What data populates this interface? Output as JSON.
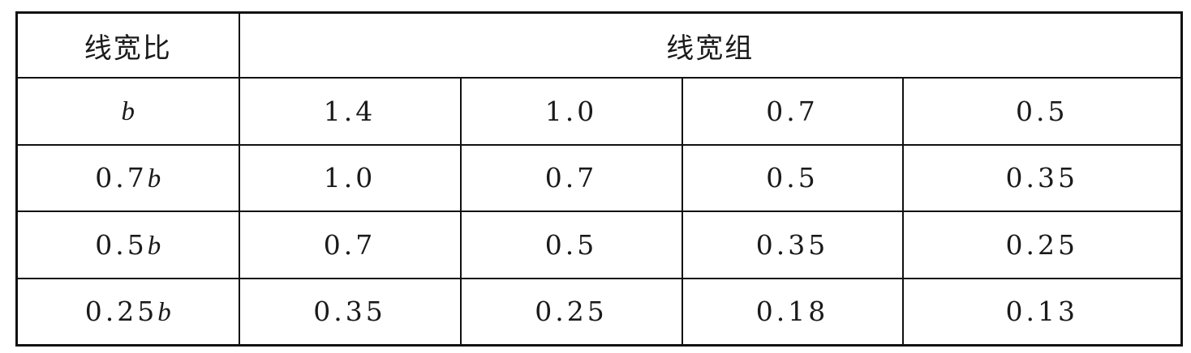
{
  "table": {
    "header": {
      "ratio_label": "线宽比",
      "group_label": "线宽组"
    },
    "rows": [
      {
        "ratio_num": "",
        "ratio_var": "b",
        "values": [
          "1.4",
          "1.0",
          "0.7",
          "0.5"
        ]
      },
      {
        "ratio_num": "0.7",
        "ratio_var": "b",
        "values": [
          "1.0",
          "0.7",
          "0.5",
          "0.35"
        ]
      },
      {
        "ratio_num": "0.5",
        "ratio_var": "b",
        "values": [
          "0.7",
          "0.5",
          "0.35",
          "0.25"
        ]
      },
      {
        "ratio_num": "0.25",
        "ratio_var": "b",
        "values": [
          "0.35",
          "0.25",
          "0.18",
          "0.13"
        ]
      }
    ]
  }
}
